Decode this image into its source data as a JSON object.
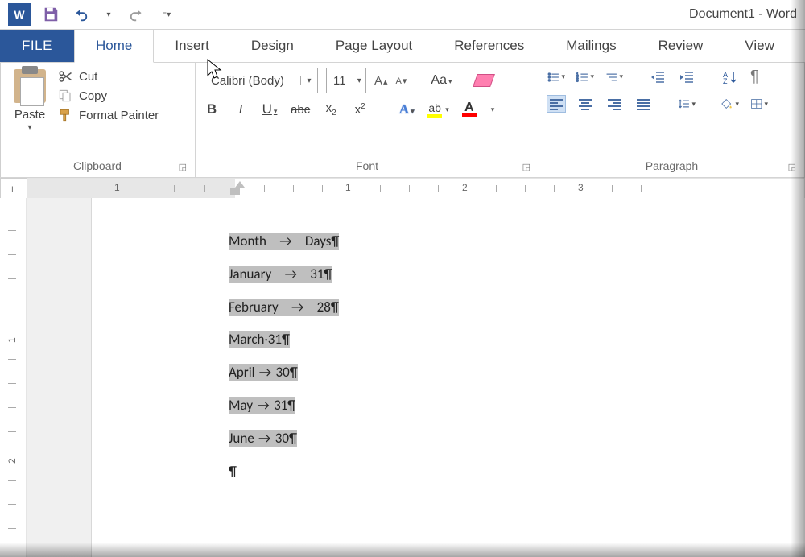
{
  "title_bar": {
    "app_abbrev": "W",
    "doc_title": "Document1 - Word"
  },
  "tabs": {
    "file": "FILE",
    "home": "Home",
    "insert": "Insert",
    "design": "Design",
    "page_layout": "Page Layout",
    "references": "References",
    "mailings": "Mailings",
    "review": "Review",
    "view": "View"
  },
  "ribbon": {
    "clipboard": {
      "paste": "Paste",
      "cut": "Cut",
      "copy": "Copy",
      "format_painter": "Format Painter",
      "label": "Clipboard"
    },
    "font": {
      "name": "Calibri (Body)",
      "size": "11",
      "grow": "A",
      "shrink": "A",
      "change_case": "Aa",
      "bold": "B",
      "italic": "I",
      "underline": "U",
      "strike": "abc",
      "sub_base": "x",
      "sub_s": "2",
      "sup_base": "x",
      "sup_s": "2",
      "fx": "A",
      "hl_pen": "ab",
      "fc_letter": "A",
      "label": "Font"
    },
    "paragraph": {
      "label": "Paragraph",
      "pilcrow": "¶"
    }
  },
  "ruler": {
    "n1a": "1",
    "n1": "1",
    "n2": "2",
    "n3": "3"
  },
  "v_ruler": {
    "n1": "1",
    "n2": "2"
  },
  "document": {
    "lines": [
      {
        "a": "Month",
        "tab": "wide",
        "b": "Days¶"
      },
      {
        "a": "January",
        "tab": "wide",
        "b": "31¶"
      },
      {
        "a": "February",
        "tab": "wide",
        "b": "28¶"
      },
      {
        "a": "March·31¶",
        "tab": "",
        "b": ""
      },
      {
        "a": "April",
        "tab": "small",
        "b": "30¶"
      },
      {
        "a": "May",
        "tab": "small",
        "b": "31¶"
      },
      {
        "a": "June",
        "tab": "small",
        "b": "30¶"
      }
    ],
    "end_p": "¶"
  }
}
